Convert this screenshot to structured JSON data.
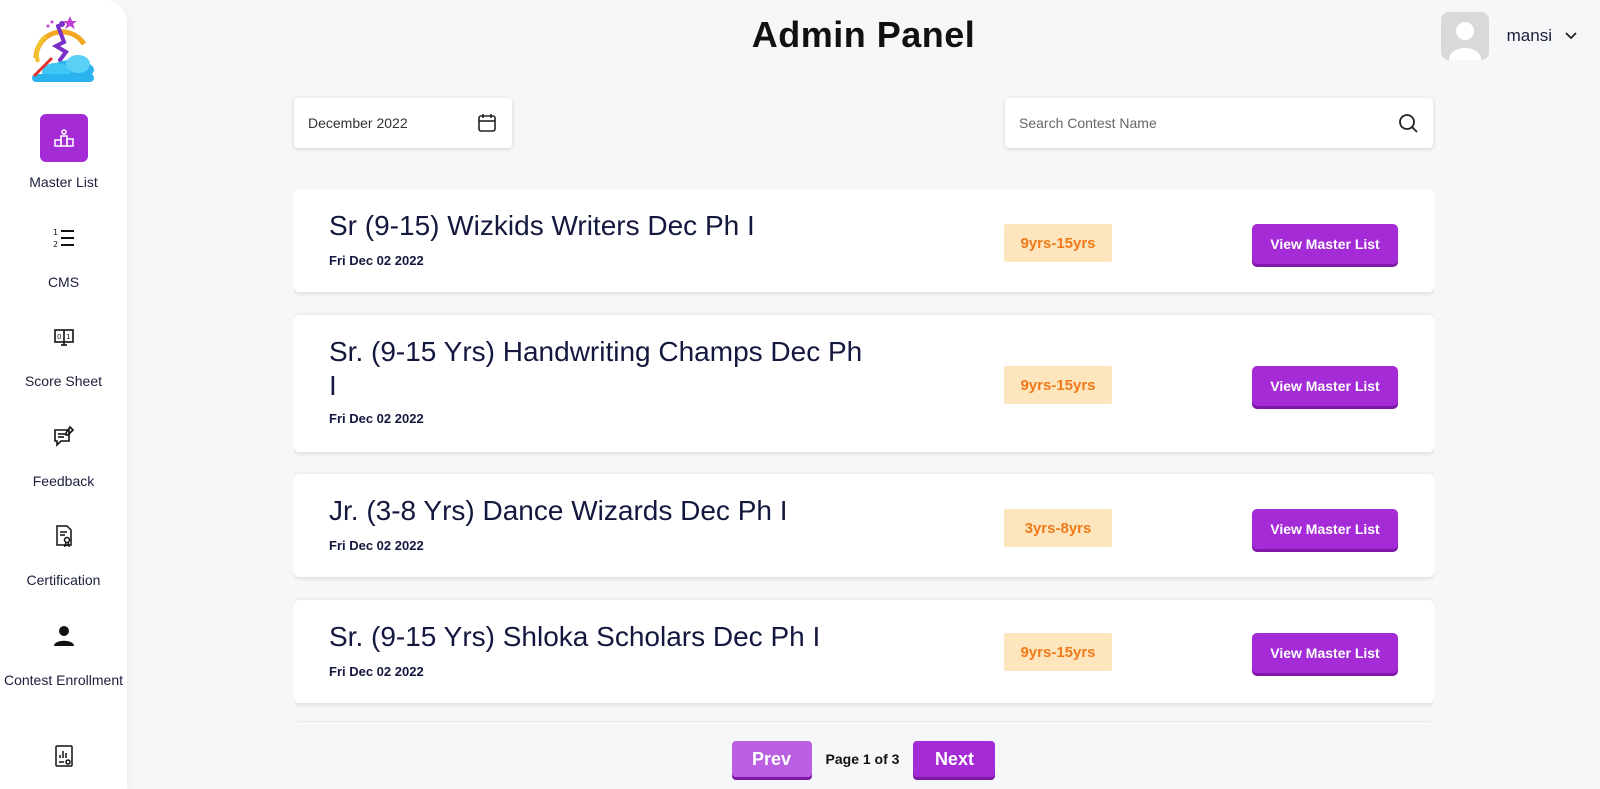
{
  "header": {
    "title": "Admin Panel",
    "user_name": "mansi"
  },
  "sidebar": {
    "items": [
      {
        "label": "Master List",
        "icon": "podium-icon",
        "active": true
      },
      {
        "label": "CMS",
        "icon": "numbered-list-icon"
      },
      {
        "label": "Score Sheet",
        "icon": "scoreboard-icon"
      },
      {
        "label": "Feedback",
        "icon": "feedback-icon"
      },
      {
        "label": "Certification",
        "icon": "certificate-icon"
      },
      {
        "label": "Contest Enrollment",
        "icon": "person-icon"
      },
      {
        "label": "",
        "icon": "report-icon"
      }
    ]
  },
  "filters": {
    "month": "December 2022",
    "search_placeholder": "Search Contest Name",
    "search_value": ""
  },
  "contests": [
    {
      "title": "Sr (9-15) Wizkids Writers Dec Ph I",
      "date": "Fri Dec 02 2022",
      "age": "9yrs-15yrs",
      "action": "View Master List"
    },
    {
      "title": "Sr. (9-15 Yrs) Handwriting Champs Dec Ph I",
      "date": "Fri Dec 02 2022",
      "age": "9yrs-15yrs",
      "action": "View Master List"
    },
    {
      "title": "Jr. (3-8 Yrs) Dance Wizards Dec Ph I",
      "date": "Fri Dec 02 2022",
      "age": "3yrs-8yrs",
      "action": "View Master List"
    },
    {
      "title": "Sr. (9-15 Yrs) Shloka Scholars Dec Ph I",
      "date": "Fri Dec 02 2022",
      "age": "9yrs-15yrs",
      "action": "View Master List"
    }
  ],
  "pagination": {
    "prev_label": "Prev",
    "next_label": "Next",
    "page_text": "Page 1 of 3"
  },
  "colors": {
    "accent": "#a42bd6",
    "badge_bg": "#fde5bd",
    "badge_text": "#f07a1a"
  }
}
